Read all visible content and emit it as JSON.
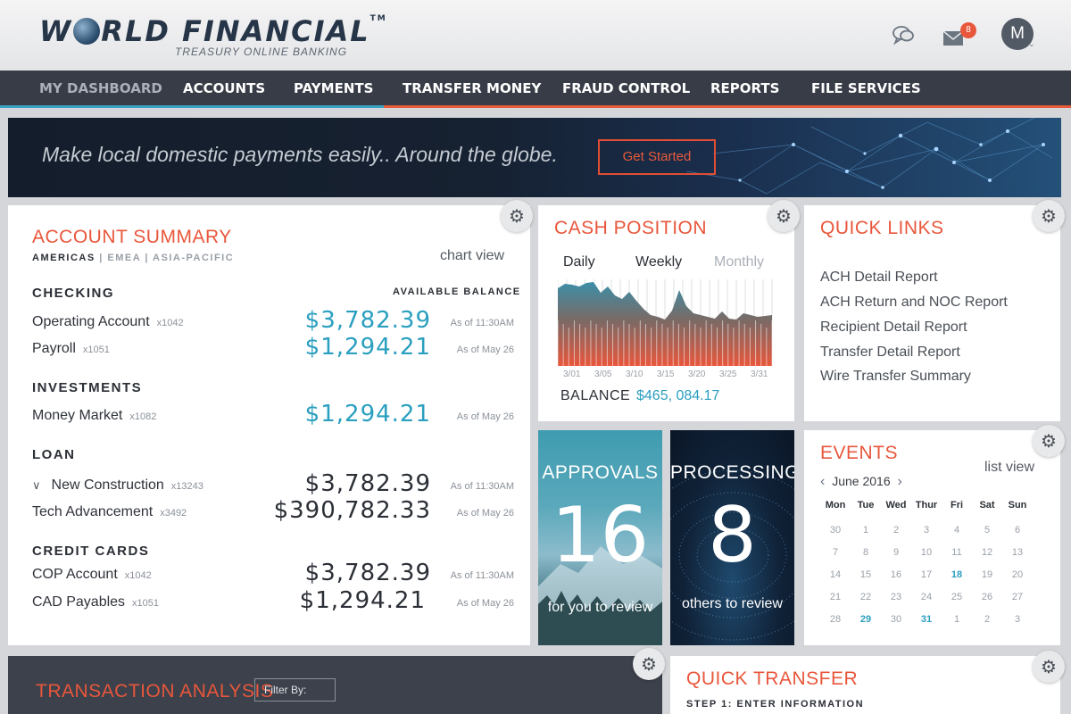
{
  "brand": {
    "name_part1": "W",
    "name_part2": "RLD FINANCIAL",
    "tm": "TM",
    "subtitle": "TREASURY ONLINE BANKING"
  },
  "header": {
    "mail_count": "8",
    "user_initial": "M"
  },
  "nav": {
    "items": [
      {
        "label": "MY DASHBOARD"
      },
      {
        "label": "ACCOUNTS"
      },
      {
        "label": "PAYMENTS"
      },
      {
        "label": "TRANSFER MONEY"
      },
      {
        "label": "FRAUD CONTROL"
      },
      {
        "label": "REPORTS"
      },
      {
        "label": "FILE SERVICES"
      }
    ]
  },
  "banner": {
    "text": "Make local domestic payments easily.. Around the globe.",
    "button": "Get Started"
  },
  "account_summary": {
    "title": "ACCOUNT SUMMARY",
    "regions": [
      "AMERICAS",
      "| EMEA",
      "| ASIA-PACIFIC"
    ],
    "chart_view": "chart view",
    "available_balance": "AVAILABLE BALANCE",
    "sections": {
      "checking": "CHECKING",
      "investments": "INVESTMENTS",
      "loan": "LOAN",
      "credit_cards": "CREDIT CARDS"
    },
    "accounts": [
      {
        "name": "Operating Account",
        "id": "x1042",
        "amount": "$3,782.39",
        "asof": "As of 11:30AM"
      },
      {
        "name": "Payroll",
        "id": "x1051",
        "amount": "$1,294.21",
        "asof": "As of May 26"
      },
      {
        "name": "Money Market",
        "id": "x1082",
        "amount": "$1,294.21",
        "asof": "As of May 26"
      },
      {
        "name": "New Construction",
        "id": "x13243",
        "amount": "$3,782.39",
        "asof": "As of 11:30AM"
      },
      {
        "name": "Tech Advancement",
        "id": "x3492",
        "amount": "$390,782.33",
        "asof": "As of May 26"
      },
      {
        "name": "COP Account",
        "id": "x1042",
        "amount": "$3,782.39",
        "asof": "As of 11:30AM"
      },
      {
        "name": "CAD Payables",
        "id": "x1051",
        "amount": "$1,294.21",
        "asof": "As of May 26"
      }
    ]
  },
  "cash_position": {
    "title": "CASH POSITION",
    "tabs": [
      "Daily",
      "Weekly",
      "Monthly"
    ],
    "x_labels": [
      "3/01",
      "3/05",
      "3/10",
      "3/15",
      "3/20",
      "3/25",
      "3/31"
    ],
    "balance_label": "BALANCE",
    "balance_value": "$465, 084.17"
  },
  "quick_links": {
    "title": "QUICK LINKS",
    "items": [
      "ACH Detail Report",
      "ACH Return and NOC Report",
      "Recipient Detail Report",
      "Transfer Detail Report",
      "Wire Transfer Summary"
    ]
  },
  "approvals": {
    "title": "APPROVALS",
    "count": "16",
    "subtitle": "for you to review"
  },
  "processing": {
    "title": "PROCESSING",
    "count": "8",
    "subtitle": "others to review"
  },
  "events": {
    "title": "EVENTS",
    "list_view": "list view",
    "month": "June 2016",
    "weekdays": [
      "Mon",
      "Tue",
      "Wed",
      "Thur",
      "Fri",
      "Sat",
      "Sun"
    ],
    "days": [
      [
        "30",
        "1",
        "2",
        "3",
        "4",
        "5",
        "6"
      ],
      [
        "7",
        "8",
        "9",
        "10",
        "11",
        "12",
        "13"
      ],
      [
        "14",
        "15",
        "16",
        "17",
        "18",
        "19",
        "20"
      ],
      [
        "21",
        "22",
        "23",
        "24",
        "25",
        "26",
        "27"
      ],
      [
        "28",
        "29",
        "30",
        "31",
        "1",
        "2",
        "3"
      ]
    ]
  },
  "transaction_analysis": {
    "title": "TRANSACTION ANALYSIS",
    "filter": "Filter By:"
  },
  "quick_transfer": {
    "title": "QUICK TRANSFER",
    "step": "STEP 1: ENTER INFORMATION"
  },
  "colors": {
    "accent": "#e8573c",
    "teal": "#2a9fbf",
    "nav": "#373c46"
  },
  "icons": [
    "chat-icon",
    "mail-icon",
    "gear-icon",
    "chevron-down-icon",
    "chevron-left-icon",
    "chevron-right-icon"
  ]
}
